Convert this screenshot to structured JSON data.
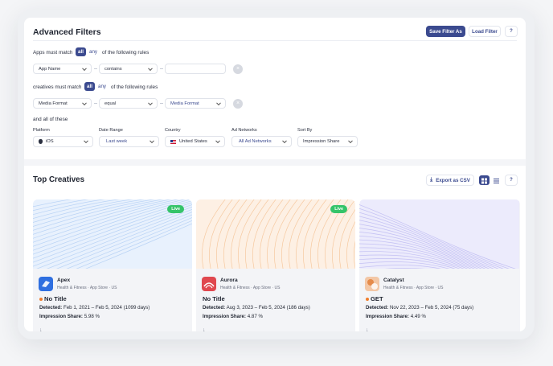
{
  "filters": {
    "title": "Advanced Filters",
    "save_label": "Save Filter As",
    "load_label": "Load Filter",
    "help": "?",
    "rule1": {
      "prefix": "Apps must match",
      "all": "all",
      "any": "any",
      "suffix": "of the following rules",
      "field": "App Name",
      "operator": "contains",
      "value": ""
    },
    "rule2": {
      "prefix": "creatives must match",
      "all": "all",
      "any": "any",
      "suffix": "of the following rules",
      "field": "Media Format",
      "operator": "equal",
      "value": "Media Format"
    },
    "and_all": "and all of these",
    "dims": [
      {
        "label": "Platform",
        "value": "iOS"
      },
      {
        "label": "Date Range",
        "value": "Last week"
      },
      {
        "label": "Country",
        "value": "United States"
      },
      {
        "label": "Ad Networks",
        "value": "All Ad Networks"
      },
      {
        "label": "Sort By",
        "value": "Impression Share"
      }
    ]
  },
  "creatives": {
    "title": "Top Creatives",
    "export_label": "Export as CSV",
    "help": "?",
    "cards": [
      {
        "live": "Live",
        "app": "Apex",
        "meta": "Health & Fitness · App Store · US",
        "ad_title": "No Title",
        "detected_label": "Detected:",
        "detected": "Feb 1, 2021 – Feb 5, 2024 (1099 days)",
        "share_label": "Impression Share:",
        "share": "5.98 %",
        "accent": "#3b82f6"
      },
      {
        "live": "Live",
        "app": "Aurora",
        "meta": "Health & Fitness · App Store · US",
        "ad_title": "No Title",
        "detected_label": "Detected:",
        "detected": "Aug 3, 2023 – Feb 5, 2024 (186 days)",
        "share_label": "Impression Share:",
        "share": "4.87 %",
        "accent": "#f97316"
      },
      {
        "app": "Catalyst",
        "meta": "Health & Fitness · App Store · US",
        "ad_title": "GET",
        "detected_label": "Detected:",
        "detected": "Nov 22, 2023 – Feb 5, 2024 (75 days)",
        "share_label": "Impression Share:",
        "share": "4.49 %",
        "accent": "#6366f1"
      }
    ]
  }
}
